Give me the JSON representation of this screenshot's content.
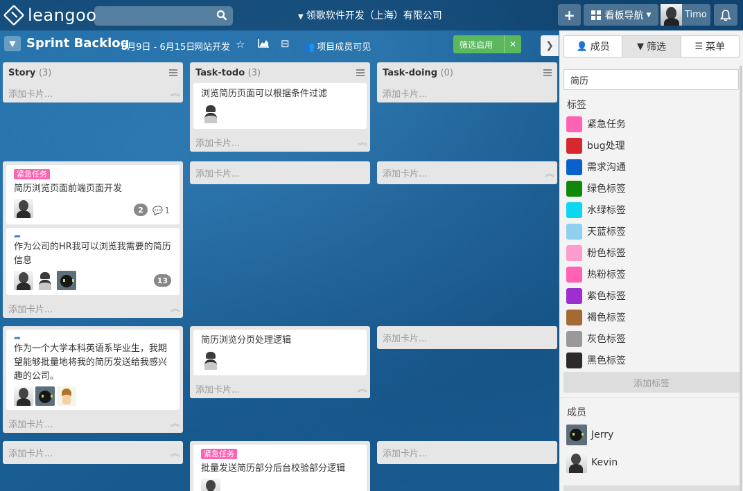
{
  "top": {
    "logo_text": "leangoo",
    "search_placeholder": "",
    "org_name": "领歌软件开发（上海）有限公司",
    "plus_label": "+",
    "board_nav_label": "看板导航",
    "user_name": "Timo"
  },
  "board": {
    "title": "Sprint Backlog",
    "date_range": "6月9日 - 6月15日",
    "project": "网站开发",
    "visibility": "项目成员可见",
    "filter_label": "筛选启用"
  },
  "common": {
    "add_card": "添加卡片..."
  },
  "lists": [
    {
      "title": "Story",
      "count": "(3)"
    },
    {
      "title": "Task-todo",
      "count": "(3)"
    },
    {
      "title": "Task-doing",
      "count": "(0)"
    }
  ],
  "cards": {
    "todo1": {
      "title": "浏览简历页面可以根据条件过滤"
    },
    "story1": {
      "label": "紧急任务",
      "title": "简历浏览页面前端页面开发",
      "badge": "2",
      "comments": "1"
    },
    "story2": {
      "title": "作为公司的HR我可以浏览我需要的简历信息",
      "badge": "13"
    },
    "story3": {
      "title": "作为一个大学本科英语系毕业生，我期望能够批量地将我的简历发送给我感兴趣的公司。"
    },
    "todo2": {
      "title": "简历浏览分页处理逻辑"
    },
    "todo3": {
      "label": "紧急任务",
      "title": "批量发送简历部分后台校验部分逻辑"
    }
  },
  "panel": {
    "tabs": [
      "成员",
      "筛选",
      "菜单"
    ],
    "filter_value": "简历",
    "labels_title": "标签",
    "labels": [
      {
        "name": "紧急任务",
        "color": "#ff62b2"
      },
      {
        "name": "bug处理",
        "color": "#d6282d"
      },
      {
        "name": "需求沟通",
        "color": "#0a61c9"
      },
      {
        "name": "绿色标签",
        "color": "#10890b"
      },
      {
        "name": "水绿标签",
        "color": "#0bd7f3"
      },
      {
        "name": "天蓝标签",
        "color": "#8ed0ef"
      },
      {
        "name": "粉色标签",
        "color": "#ff9ccd"
      },
      {
        "name": "热粉标签",
        "color": "#ff62b2"
      },
      {
        "name": "紫色标签",
        "color": "#9d2fcf"
      },
      {
        "name": "褐色标签",
        "color": "#a36a31"
      },
      {
        "name": "灰色标签",
        "color": "#999999"
      },
      {
        "name": "黑色标签",
        "color": "#2b2b2b"
      }
    ],
    "add_label": "添加标签",
    "members_title": "成员",
    "members": [
      {
        "name": "Jerry",
        "avatar": "black-cat"
      },
      {
        "name": "Kevin",
        "avatar": "man-photo"
      }
    ]
  }
}
